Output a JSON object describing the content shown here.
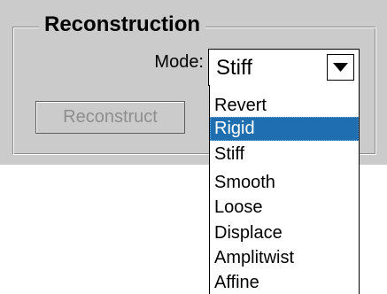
{
  "group": {
    "title": "Reconstruction"
  },
  "mode": {
    "label": "Mode:",
    "value": "Stiff",
    "options": [
      "Revert",
      "Rigid",
      "Stiff",
      "Smooth",
      "Loose",
      "Displace",
      "Amplitwist",
      "Affine"
    ],
    "highlighted": "Rigid"
  },
  "actions": {
    "reconstruct_label": "Reconstruct",
    "reconstruct_enabled": false
  },
  "icons": {
    "dropdown_arrow": "triangle-down-icon"
  },
  "colors": {
    "panel": "#cbcbcb",
    "highlight": "#1f6fb0",
    "disabled_text": "#8e8e8e"
  }
}
